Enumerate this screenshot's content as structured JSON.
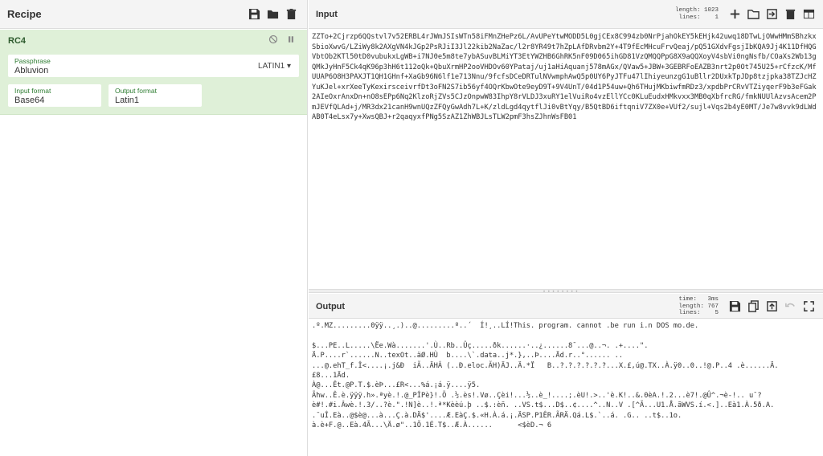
{
  "recipe": {
    "title": "Recipe",
    "operation": {
      "name": "RC4",
      "passphrase_label": "Passphrase",
      "passphrase_value": "Abluvion",
      "passphrase_encoding": "LATIN1 ▾",
      "input_format_label": "Input format",
      "input_format_value": "Base64",
      "output_format_label": "Output format",
      "output_format_value": "Latin1"
    }
  },
  "input": {
    "title": "Input",
    "length_label": "length:",
    "length_value": "1023",
    "lines_label": "lines:",
    "lines_value": "1",
    "text": "ZZTo+2Cjrzp6QQstvl7v52ERBL4rJWmJSIsWTn58iFMnZHePz6L/AvUPeYtwMODD5L0gjCEx8C994zb0NrPjahOkEY5kEHjk42uwq18DTwLjOWwHMmSBhzkxSbioXwvG/LZiWy8k2AXgVN4kJGp2PsRJiI3Jl22kib2NaZac/l2r8YR49t7hZpLAfDRvbm2Y+4T9fEcMHcuFrvQeaj/pQ51GXdvFgsjIbKQA9Jj4K11DfHQGVbtOb2KTl50tD0vubukxLgWB+i7NJ0e5m8te7ybASuvBLMiYT3EtYWZHB6GhRK5nF09D065ihGD81VzQMQQPpG8X9aQQXoyV4sbVi0ngNsfb/COaXs2Wb13gQMkJyHnF5Ck4qK96p3hH6t112oQk+QbuXrmHP2ooVHDOv60YPataj/uj1aHiAquanj578mAGx/QVaw5+JBW+3GEBRFoEAZB3nrt2p0Ot745U25+rCfzcK/MfUUAP6O8H3PAXJT1QH1GHnf+XaGb96N6lf1e713Nnu/9fcfsDCeDRTulNVwmphAwQ5p0UY6PyJTFu47lIhiyeunzgG1uBllr2DUxkTpJDp8tzjpka38TZJcHZYuKJel+xrXeeTyKexirsceivrfDt3oFN2S7ib56yf4OQrKbwOte9eyD9T+9V4UnT/04d1P54uw+Qh6THujMKbiwfmRDz3/xpdbPrCRvVTZiyqerF9b3eFGak2AIeOxrAnxDn+nO8sEPp6Nq2KlzoRjZVs5CJzOnpwW83IhpY8rVLDJ3xuRY1elVuiRo4vzEllYCc0KLuEudxHMkvxx3MB0qXbfrcRG/fmkNUUlAzvsAcem2PmJEVfQLAd+j/MR3dx21canH9wnUQzZFQyGwAdh7L+K/zldLgd4qytflJi0vBtYqy/B5QtBD6iftqniV7ZX0e+VUf2/sujl+Vqs2b4yE0MT/Je7w8vvk9dLWdAB0T4eLsx7y+XwsQBJ+r2qaqyxfPNg5SzAZ1ZhWBJLsTLW2pmF3hsZJhnWsFB01"
  },
  "output": {
    "title": "Output",
    "time_label": "time:",
    "time_value": "3ms",
    "length_label": "length:",
    "length_value": "767",
    "lines_label": "lines:",
    "lines_value": "5",
    "text": ".º.MZ.........0ÿÿ..¸.)..@.........º..´  Í!¸..LÍ!This. program. cannot .be run i.n DOS mo.de.\n\n$...PE..L.....\\Ëe.Wà.......'.Ù..Rb..Ûç.....ðk......·..¿......8¯...@..¬. .+....\".\nÄ.P....r`......N..texOt..äØ.HÙ  b....\\`.data..j*.},..Þ....Äd.r..°...... ..\n...@.ehT_f.Î<....¡.j&Ð  iÃ..ÄHÂ (..Ð.eloc.ÃH)ÄJ..Ä.*Ï   B..?.?.?.?.?.?...X.£,ú@.TX..À.ÿ0..0..!@.P..4 .è......Ä.\n£8...1Äd.\nÀ@...Êt.@P.T.$.èÞ...£R<...%á.¡á.ÿ....ÿ5.\nÃhw..Ê.è.ÿÿÿ.h».ªyè.!.@_PÎPè}!.Ö .½.ès!.Vø..Çèi!...½..è_!....;.èU!.>..'è.K!..&.0èA.!.2...è7!.@Û^.¬è-!.. u¯?\nè#!.#i.Âwè.!.3/..?è.\".!N]è..!.ª*Kèèú.þ ..$.:èñ. ..VS.t$...D$..¢....^..N..V .[^Ã...U1.Å.ãWVS.í.<.]..Eà1.À.5ð.A.\n.¯uÎ.Eà..@$è@...à...Ç.à.DÄ$'....Æ.EàÇ.$.«H.À.á.¡.ÄSP.P1ÊR.ÃRÄ.Qá.L$.`..á. .G.. ..t$..1o.\nà.è+F.@..Eà.4Ã...\\Ä.ø\"..1Õ.1É.T$..Æ.À......      <$èD.¬ 6"
  },
  "colors": {
    "recipe_op_bg": "#dff0d8",
    "field_label": "#2e7d32",
    "header_bg": "#f4f4f4"
  }
}
